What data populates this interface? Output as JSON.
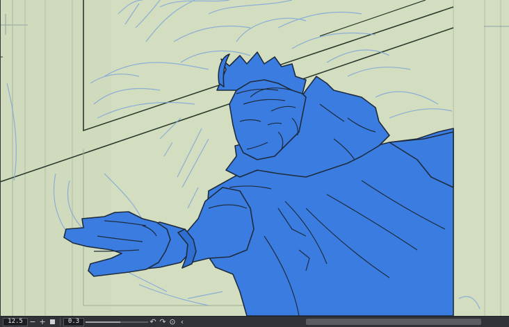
{
  "zoom": {
    "value": "12.5"
  },
  "rotation": {
    "value": "0.3"
  },
  "slider": {
    "level": 0.55
  },
  "colors": {
    "paper": "#d3ddc0",
    "fill": "#3a7ce0",
    "line": "#1d2b3d",
    "sketch": "#7fa6d8",
    "statusbar": "#2f3236"
  },
  "icons": [
    "zoom-out-icon",
    "zoom-in-icon",
    "fit-icon",
    "undo-icon",
    "redo-icon",
    "reset-rotation-icon",
    "flip-icon"
  ]
}
